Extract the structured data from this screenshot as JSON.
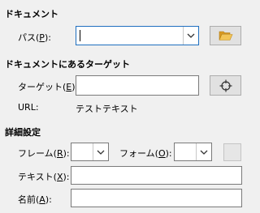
{
  "document": {
    "section_title": "ドキュメント",
    "path_label": "パス(",
    "path_key": "P",
    "path_close": "):",
    "path_value": ""
  },
  "target_in_document": {
    "section_title": "ドキュメントにあるターゲット",
    "target_label": "ターゲット(",
    "target_key": "E",
    "target_close": "):",
    "target_value": "",
    "url_label": "URL:",
    "url_value": "テストテキスト"
  },
  "advanced": {
    "section_title": "詳細設定",
    "frame_label": "フレーム(",
    "frame_key": "R",
    "frame_close": "):",
    "frame_value": "",
    "form_label": "フォーム(",
    "form_key": "O",
    "form_close": "):",
    "form_value": "",
    "text_label": "テキスト(",
    "text_key": "X",
    "text_close": "):",
    "text_value": "",
    "name_label": "名前(",
    "name_key": "A",
    "name_close": "):",
    "name_value": ""
  },
  "icons": {
    "open_file": "folder-open-icon",
    "target_picker": "crosshair-target-icon",
    "dropdown": "chevron-down-icon",
    "events": "events-icon"
  },
  "colors": {
    "folder": "#e9b43c",
    "focus_border": "#1f6fbf"
  }
}
